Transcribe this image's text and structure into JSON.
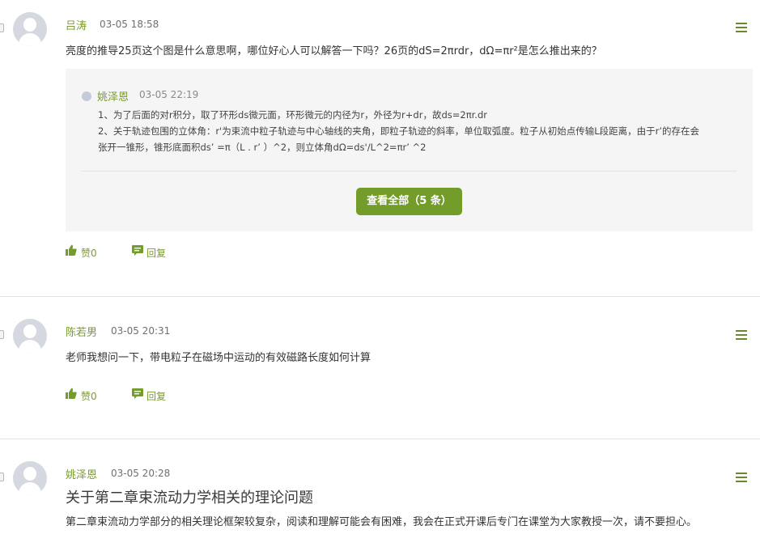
{
  "comments": [
    {
      "author": "吕涛",
      "time": "03-05 18:58",
      "content": "亮度的推导25页这个图是什么意思啊，哪位好心人可以解答一下吗？26页的dS=2πrdr，dΩ=πr²是怎么推出来的？",
      "reply": {
        "author": "姚泽恩",
        "time": "03-05 22:19",
        "lines": [
          "1、为了后面的对r积分，取了环形ds微元面，环形微元的内径为r，外径为r+dr，故ds=2πr.dr",
          "2、关于轨迹包围的立体角：r'为束流中粒子轨迹与中心轴线的夹角，即粒子轨迹的斜率，单位取弧度。粒子从初始点传输L段距离，由于r’的存在会",
          "张开一锥形，锥形底面积ds’ =π（L . r’ ）^2，则立体角dΩ=ds'/L^2=πr’ ^2"
        ],
        "view_all_label": "查看全部（5 条）"
      },
      "like_label": "赞0",
      "reply_label": "回复"
    },
    {
      "author": "陈若男",
      "time": "03-05 20:31",
      "content": "老师我想问一下，带电粒子在磁场中运动的有效磁路长度如何计算",
      "like_label": "赞0",
      "reply_label": "回复"
    },
    {
      "author": "姚泽恩",
      "time": "03-05 20:28",
      "title": "关于第二章束流动力学相关的理论问题",
      "content": "第二章束流动力学部分的相关理论框架较复杂，阅读和理解可能会有困难，我会在正式开课后专门在课堂为大家教授一次，请不要担心。"
    }
  ],
  "colors": {
    "accent": "#739c2b",
    "author": "#7a9a30",
    "reply_bg": "#f5f5f5"
  },
  "icons": [
    "thumbs-up-icon",
    "comment-bubble-icon",
    "menu-icon",
    "avatar-icon"
  ]
}
